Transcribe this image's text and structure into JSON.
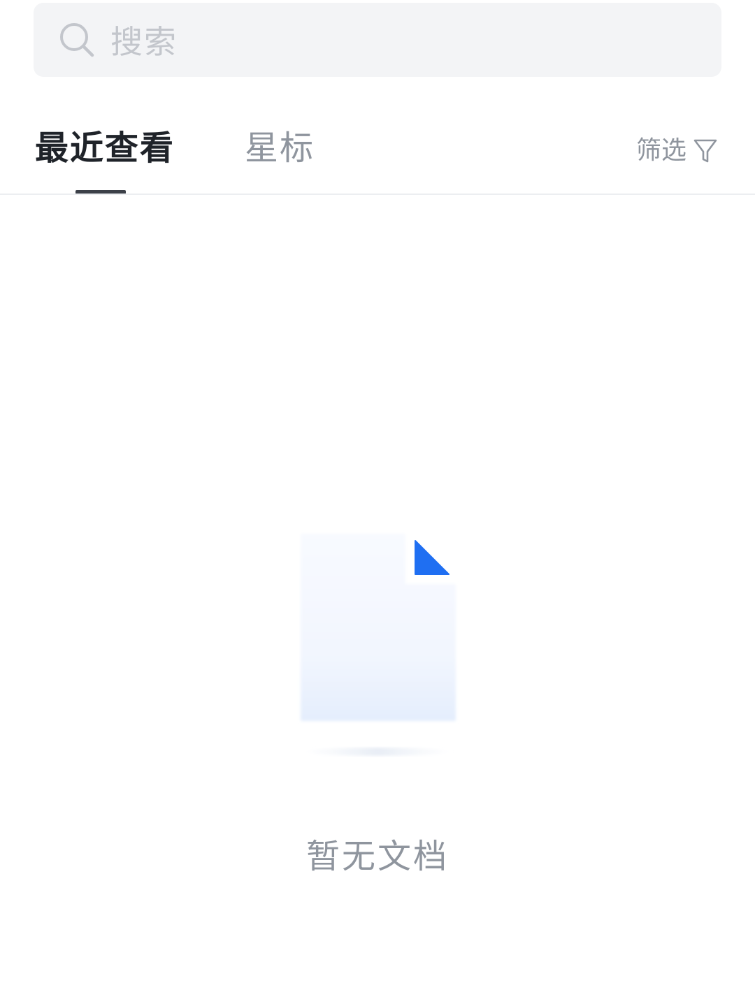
{
  "search": {
    "placeholder": "搜索",
    "icon": "search-icon"
  },
  "tabs": [
    {
      "label": "最近查看",
      "active": true
    },
    {
      "label": "星标",
      "active": false
    }
  ],
  "filter": {
    "label": "筛选",
    "icon": "filter-funnel-icon"
  },
  "empty_state": {
    "illustration": "document-icon",
    "message": "暂无文档"
  },
  "colors": {
    "accent_blue": "#1f6ff2",
    "active_tab": "#1f2329",
    "inactive_text": "#8f959e",
    "search_bg": "#f3f4f6"
  }
}
